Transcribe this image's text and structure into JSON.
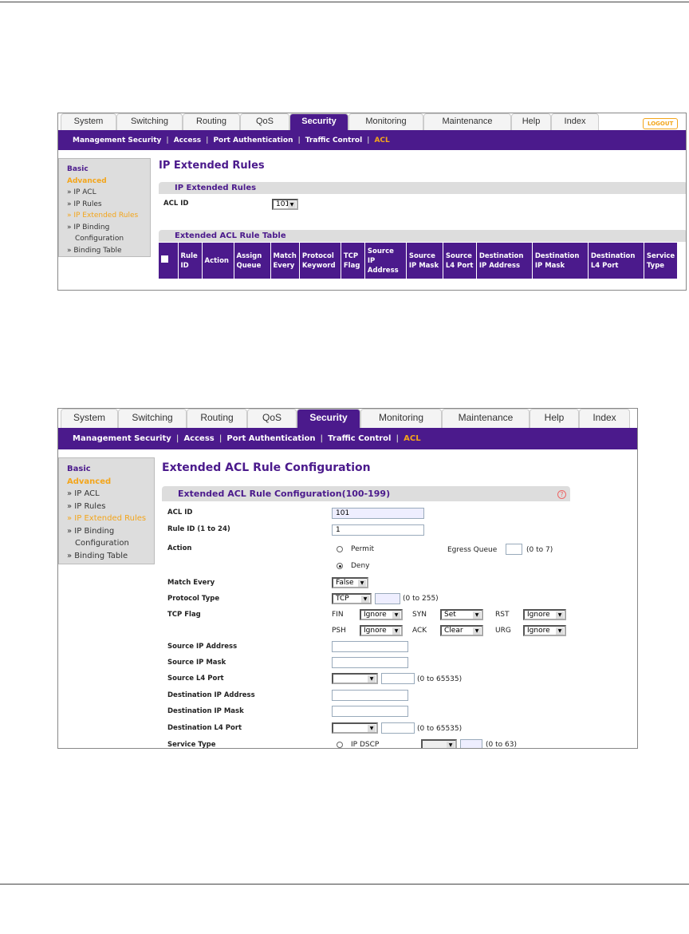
{
  "tabs": [
    "System",
    "Switching",
    "Routing",
    "QoS",
    "Security",
    "Monitoring",
    "Maintenance",
    "Help",
    "Index"
  ],
  "logout": "LOGOUT",
  "subnav": [
    "Management Security",
    "Access",
    "Port Authentication",
    "Traffic Control",
    "ACL"
  ],
  "sidebar": {
    "basic": "Basic",
    "advanced": "Advanced",
    "items": [
      "» IP ACL",
      "» IP Rules",
      "» IP Extended Rules",
      "» IP Binding",
      "Configuration",
      "» Binding Table"
    ]
  },
  "shot1": {
    "title": "IP Extended Rules",
    "section": "IP Extended Rules",
    "acl_label": "ACL ID",
    "acl_value": "101",
    "table_section": "Extended ACL Rule Table",
    "columns": [
      "Rule ID",
      "Action",
      "Assign Queue",
      "Match Every",
      "Protocol Keyword",
      "TCP Flag",
      "Source IP Address",
      "Source IP Mask",
      "Source L4 Port",
      "Destination IP Address",
      "Destination IP Mask",
      "Destination L4 Port",
      "Service Type"
    ]
  },
  "shot2": {
    "title": "Extended ACL Rule Configuration",
    "section": "Extended ACL Rule Configuration(100-199)",
    "labels": {
      "acl": "ACL ID",
      "rule": "Rule ID (1 to 24)",
      "action": "Action",
      "match": "Match Every",
      "proto": "Protocol Type",
      "tcp": "TCP Flag",
      "sip": "Source IP Address",
      "smask": "Source IP Mask",
      "sport": "Source L4 Port",
      "dip": "Destination IP Address",
      "dmask": "Destination IP Mask",
      "dport": "Destination L4 Port",
      "service": "Service Type"
    },
    "values": {
      "acl": "101",
      "rule": "1",
      "permit": "Permit",
      "deny": "Deny",
      "egress": "Egress Queue",
      "egress_range": "(0 to 7)",
      "match": "False",
      "proto": "TCP",
      "proto_range": "(0 to 255)",
      "port_range": "(0 to 65535)",
      "dscp": "IP DSCP",
      "dscp_range": "(0 to 63)"
    },
    "flags": {
      "fin": "FIN",
      "fin_v": "Ignore",
      "syn": "SYN",
      "syn_v": "Set",
      "rst": "RST",
      "rst_v": "Ignore",
      "psh": "PSH",
      "psh_v": "Ignore",
      "ack": "ACK",
      "ack_v": "Clear",
      "urg": "URG",
      "urg_v": "Ignore"
    }
  }
}
